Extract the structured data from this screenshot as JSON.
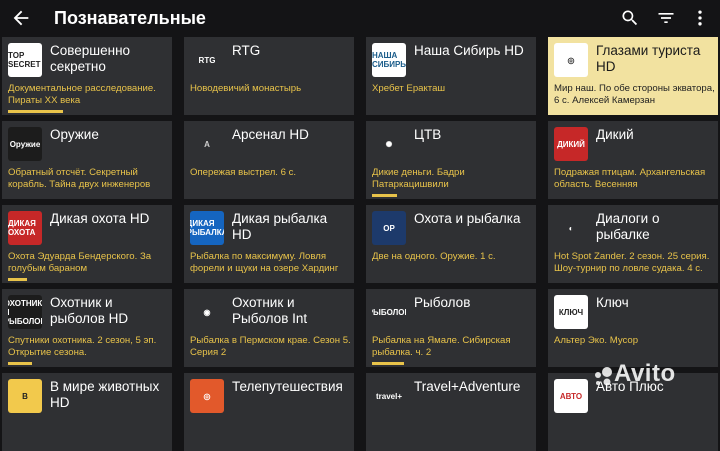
{
  "header": {
    "title": "Познавательные"
  },
  "channels": [
    {
      "name": "Совершенно секретно",
      "desc": "Документальное расследование. Пираты XX века",
      "progress": 0.35,
      "logo_text": "TOP SECRET",
      "logo_bg": "#ffffff",
      "logo_fg": "#222222"
    },
    {
      "name": "RTG",
      "desc": "Новодевичий монастырь",
      "progress": 0,
      "logo_text": "RTG",
      "logo_bg": "transparent",
      "logo_fg": "#ffffff"
    },
    {
      "name": "Наша Сибирь HD",
      "desc": "Хребет Еракташ",
      "progress": 0,
      "logo_text": "НАША СИБИРЬ",
      "logo_bg": "#ffffff",
      "logo_fg": "#1a5c8a"
    },
    {
      "name": "Глазами туриста HD",
      "desc": "Мир наш. По обе стороны экватора, 6 с. Алексей Камерзан",
      "progress": 0,
      "logo_text": "◎",
      "logo_bg": "#ffffff",
      "logo_fg": "#333333",
      "active": true
    },
    {
      "name": "Оружие",
      "desc": "Обратный отсчёт. Секретный корабль. Тайна двух инженеров",
      "progress": 0,
      "logo_text": "Оружие",
      "logo_bg": "#1c1c1c",
      "logo_fg": "#ffffff"
    },
    {
      "name": "Арсенал HD",
      "desc": "Опережая выстрел. 6 с.",
      "progress": 0,
      "logo_text": "A",
      "logo_bg": "transparent",
      "logo_fg": "#cfcfcf"
    },
    {
      "name": "ЦТВ",
      "desc": "Дикие деньги. Бадри Патаркацишвили",
      "progress": 0.16,
      "logo_text": "✺",
      "logo_bg": "transparent",
      "logo_fg": "#ffffff"
    },
    {
      "name": "Дикий",
      "desc": "Подражая птицам. Архангельская область. Весенняя",
      "progress": 0,
      "logo_text": "ДИКИЙ",
      "logo_bg": "#c62828",
      "logo_fg": "#ffffff"
    },
    {
      "name": "Дикая охота HD",
      "desc": "Охота Эдуарда Бендерского. За голубым бараном",
      "progress": 0.12,
      "logo_text": "ДИКАЯ ОХОТА",
      "logo_bg": "#c62828",
      "logo_fg": "#ffffff"
    },
    {
      "name": "Дикая рыбалка HD",
      "desc": "Рыбалка по максимуму. Ловля форели и щуки на озере Хардинг",
      "progress": 0,
      "logo_text": "ДИКАЯ РЫБАЛКА",
      "logo_bg": "#1565c0",
      "logo_fg": "#ffffff"
    },
    {
      "name": "Охота и рыбалка",
      "desc": "Две на одного. Оружие. 1 с.",
      "progress": 0,
      "logo_text": "ОР",
      "logo_bg": "#1d3a6b",
      "logo_fg": "#ffffff"
    },
    {
      "name": "Диалоги о рыбалке",
      "desc": "Hot Spot Zander. 2 сезон. 25 серия. Шоу-турнир по ловле судака. 4 с.",
      "progress": 0,
      "logo_text": "◐",
      "logo_bg": "transparent",
      "logo_fg": "#ffffff"
    },
    {
      "name": "Охотник и рыболов HD",
      "desc": "Спутники охотника. 2 сезон, 5 эп. Открытие сезона.",
      "progress": 0.15,
      "logo_text": "ОХОТНИК И РЫБОЛОВ",
      "logo_bg": "#1c1c1c",
      "logo_fg": "#ffffff"
    },
    {
      "name": "Охотник и Рыболов Int",
      "desc": "Рыбалка в Пермском крае. Сезон 5. Серия 2",
      "progress": 0,
      "logo_text": "◉",
      "logo_bg": "transparent",
      "logo_fg": "#ffffff"
    },
    {
      "name": "Рыболов",
      "desc": "Рыбалка на Ямале. Сибирская рыбалка. ч. 2",
      "progress": 0.2,
      "logo_text": "РЫБОЛОВ",
      "logo_bg": "transparent",
      "logo_fg": "#ffffff"
    },
    {
      "name": "Ключ",
      "desc": "Альтер Эко. Мусор",
      "progress": 0,
      "logo_text": "КЛЮЧ",
      "logo_bg": "#ffffff",
      "logo_fg": "#222222"
    },
    {
      "name": "В мире животных HD",
      "desc": "",
      "progress": 0,
      "logo_text": "В",
      "logo_bg": "#f2c94c",
      "logo_fg": "#222222"
    },
    {
      "name": "Телепутешествия",
      "desc": "",
      "progress": 0,
      "logo_text": "◎",
      "logo_bg": "#e2592b",
      "logo_fg": "#ffffff"
    },
    {
      "name": "Travel+Adventure",
      "desc": "",
      "progress": 0,
      "logo_text": "travel+",
      "logo_bg": "transparent",
      "logo_fg": "#ffffff"
    },
    {
      "name": "Авто Плюс",
      "desc": "",
      "progress": 0,
      "logo_text": "АВТО",
      "logo_bg": "#ffffff",
      "logo_fg": "#c62828"
    }
  ],
  "watermark": {
    "text": "Avito"
  }
}
